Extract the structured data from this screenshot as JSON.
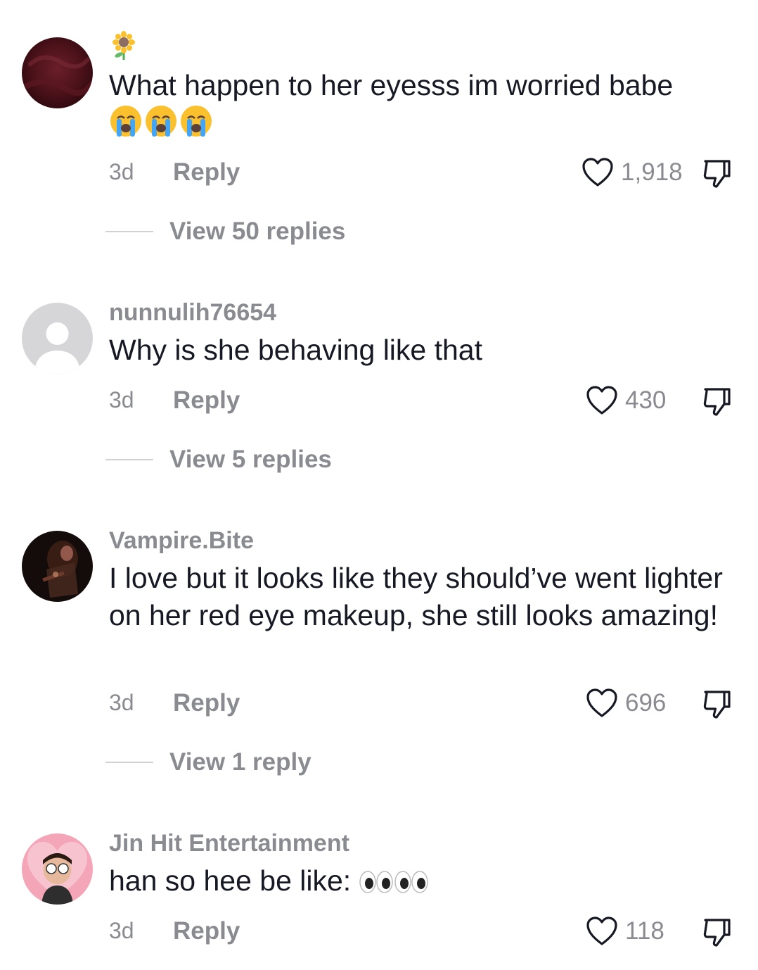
{
  "comments": [
    {
      "username": "",
      "username_emoji": "sunflower-icon",
      "text": "What happen to her eyesss im worried babe",
      "text_emoji": [
        "😭",
        "😭",
        "😭"
      ],
      "time": "3d",
      "reply_label": "Reply",
      "likes": "1,918",
      "view_replies": "View 50 replies"
    },
    {
      "username": "nunnulih76654",
      "text": "Why is she behaving like that",
      "time": "3d",
      "reply_label": "Reply",
      "likes": "430",
      "view_replies": "View 5 replies"
    },
    {
      "username": "Vampire.Bite",
      "text": "I love but it looks like they should’ve went lighter on her red eye makeup, she still looks amazing!",
      "time": "3d",
      "reply_label": "Reply",
      "likes": "696",
      "view_replies": "View 1 reply"
    },
    {
      "username": "Jin Hit Entertainment",
      "text": "han so hee be like:",
      "text_emoji": [
        "👀",
        "👀"
      ],
      "time": "3d",
      "reply_label": "Reply",
      "likes": "118"
    }
  ],
  "colors": {
    "primary_text": "#161823",
    "secondary_text": "#8a8b91",
    "divider": "#d0d1d3"
  }
}
